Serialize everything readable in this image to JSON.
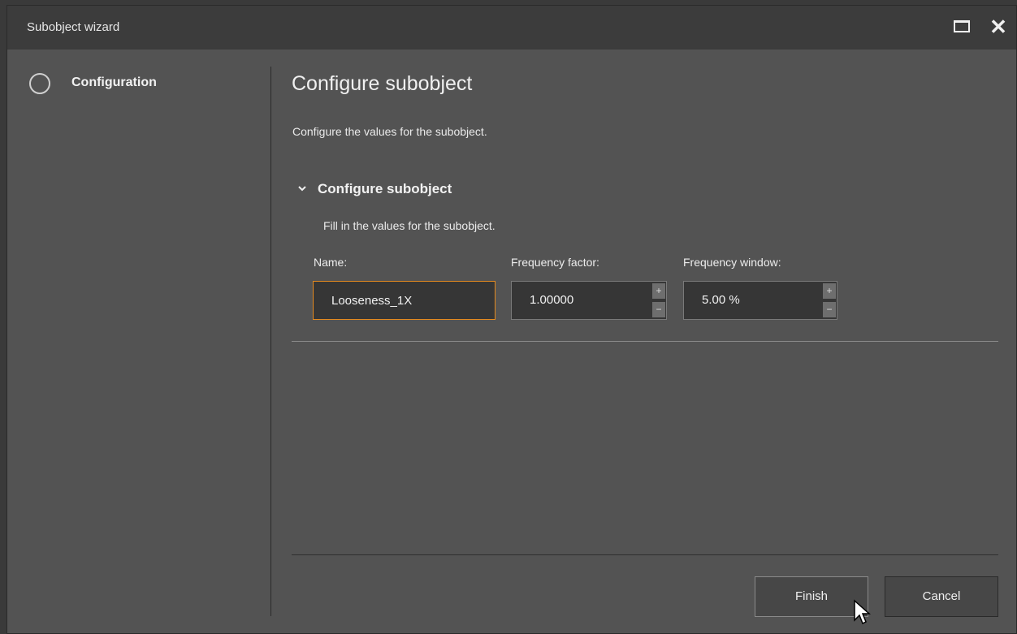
{
  "window": {
    "title": "Subobject wizard",
    "maximize_icon": "maximize-icon",
    "close_icon": "close-icon"
  },
  "sidebar": {
    "steps": [
      {
        "label": "Configuration",
        "icon": "step-circle-icon"
      }
    ]
  },
  "main": {
    "title": "Configure subobject",
    "description": "Configure the values for the subobject.",
    "section": {
      "title": "Configure subobject",
      "description": "Fill in the values for the subobject.",
      "fields": {
        "name": {
          "label": "Name:",
          "value": "Looseness_1X"
        },
        "frequency_factor": {
          "label": "Frequency factor:",
          "value": "1.00000"
        },
        "frequency_window": {
          "label": "Frequency window:",
          "value": "5.00 %"
        }
      }
    }
  },
  "spin": {
    "up": "+",
    "down": "−"
  },
  "footer": {
    "finish_label": "Finish",
    "cancel_label": "Cancel"
  },
  "colors": {
    "accent": "#e48a1f",
    "background": "#535353",
    "titlebar": "#3c3c3c"
  }
}
